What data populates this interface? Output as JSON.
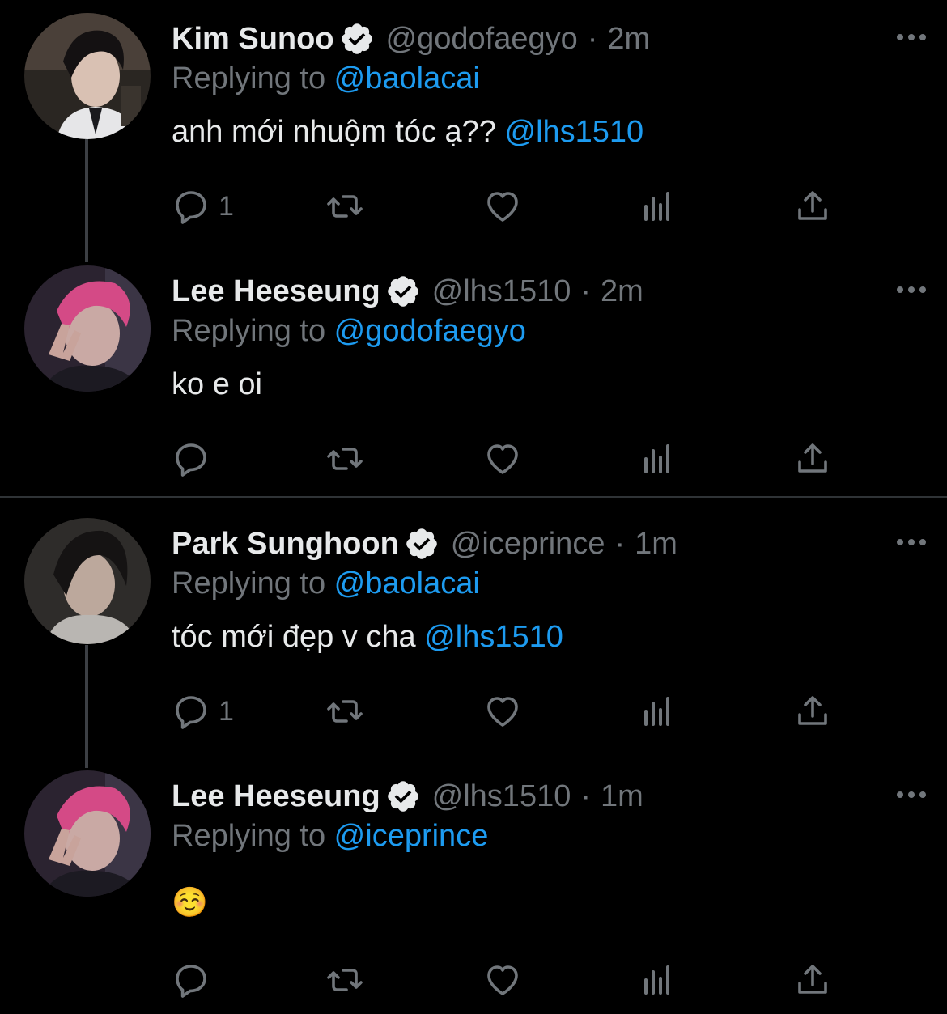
{
  "tweets": [
    {
      "name": "Kim Sunoo",
      "handle": "@godofaegyo",
      "separator": "·",
      "time": "2m",
      "replying_prefix": "Replying to ",
      "replying_to": "@baolacai",
      "text": "anh mới nhuộm tóc ạ?? ",
      "mention": "@lhs1510",
      "reply_count": "1"
    },
    {
      "name": "Lee Heeseung",
      "handle": "@lhs1510",
      "separator": "·",
      "time": "2m",
      "replying_prefix": "Replying to ",
      "replying_to": "@godofaegyo",
      "text": "ko e oi",
      "reply_count": ""
    },
    {
      "name": "Park Sunghoon",
      "handle": "@iceprince",
      "separator": "·",
      "time": "1m",
      "replying_prefix": "Replying to ",
      "replying_to": "@baolacai",
      "text": "tóc mới đẹp v cha ",
      "mention": "@lhs1510",
      "reply_count": "1"
    },
    {
      "name": "Lee Heeseung",
      "handle": "@lhs1510",
      "separator": "·",
      "time": "1m",
      "replying_prefix": "Replying to ",
      "replying_to": "@iceprince",
      "text": "☺️",
      "reply_count": ""
    }
  ],
  "icons": {
    "verified": "verified-badge-icon",
    "more": "more-options-icon",
    "reply": "reply-icon",
    "retweet": "retweet-icon",
    "like": "heart-icon",
    "analytics": "analytics-icon",
    "share": "share-icon"
  },
  "colors": {
    "background": "#000000",
    "primary_text": "#e7e9ea",
    "secondary_text": "#71767b",
    "link": "#1d9bf0",
    "divider": "#2f3336"
  }
}
